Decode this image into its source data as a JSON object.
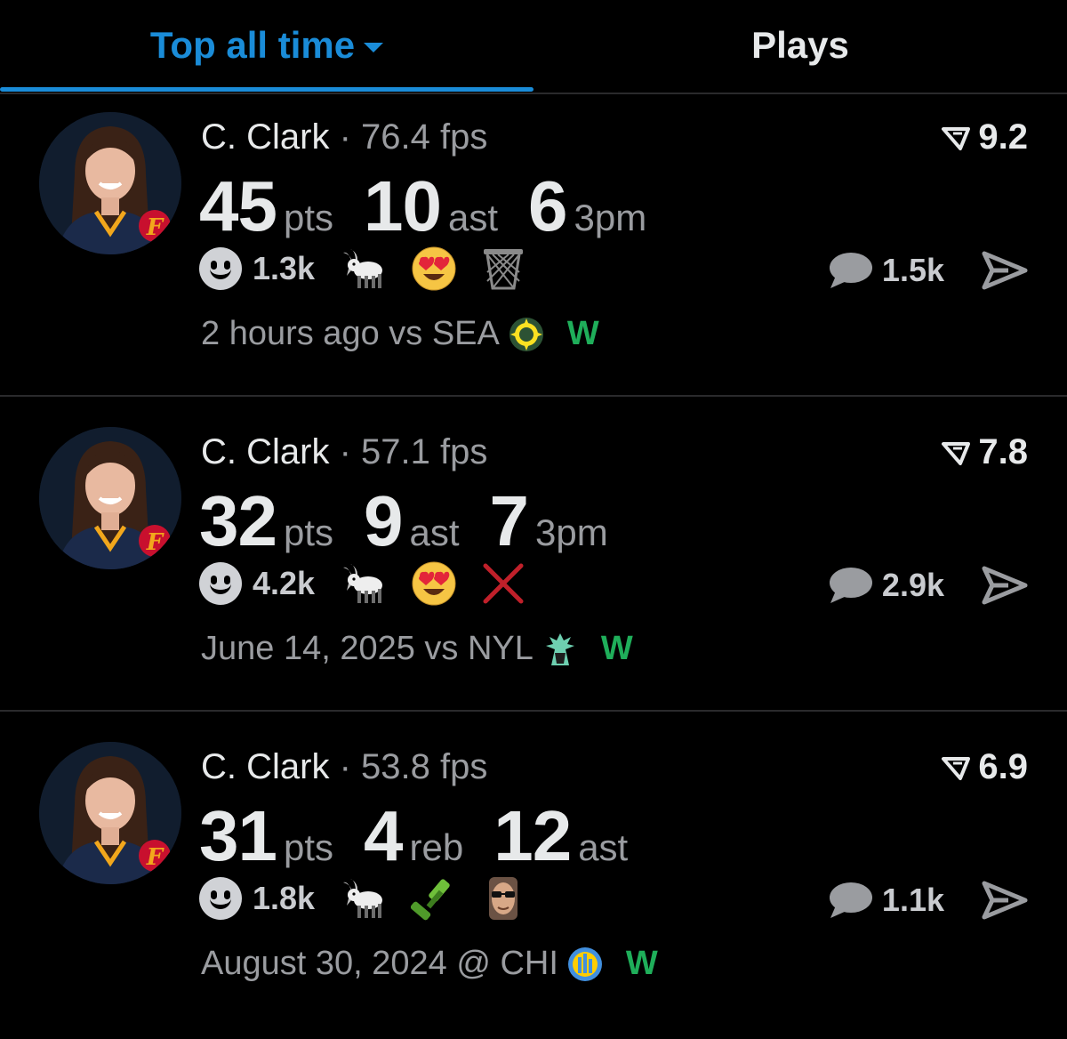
{
  "tabs": {
    "active_label": "Top all time",
    "other_label": "Plays"
  },
  "colors": {
    "accent": "#1a8cd8",
    "win": "#1fae5a",
    "muted": "#9a9ca0"
  },
  "plays": [
    {
      "name": "C. Clark",
      "separator": "·",
      "fps": "76.4 fps",
      "score": "9.2",
      "stats": [
        {
          "num": "45",
          "unit": "pts"
        },
        {
          "num": "10",
          "unit": "ast"
        },
        {
          "num": "6",
          "unit": "3pm"
        }
      ],
      "reaction_count": "1.3k",
      "emojis": [
        "goat-emoji",
        "heart-eyes-emoji",
        "basketball-hoop-emoji"
      ],
      "comment_count": "1.5k",
      "meta": "2 hours ago vs SEA",
      "team_logo": "seattle-storm-logo",
      "result": "W"
    },
    {
      "name": "C. Clark",
      "separator": "·",
      "fps": "57.1 fps",
      "score": "7.8",
      "stats": [
        {
          "num": "32",
          "unit": "pts"
        },
        {
          "num": "9",
          "unit": "ast"
        },
        {
          "num": "7",
          "unit": "3pm"
        }
      ],
      "reaction_count": "4.2k",
      "emojis": [
        "goat-emoji",
        "heart-eyes-emoji",
        "cross-mark-emoji"
      ],
      "comment_count": "2.9k",
      "meta": "June 14, 2025 vs NYL",
      "team_logo": "new-york-liberty-logo",
      "result": "W"
    },
    {
      "name": "C. Clark",
      "separator": "·",
      "fps": "53.8 fps",
      "score": "6.9",
      "stats": [
        {
          "num": "31",
          "unit": "pts"
        },
        {
          "num": "4",
          "unit": "reb"
        },
        {
          "num": "12",
          "unit": "ast"
        }
      ],
      "reaction_count": "1.8k",
      "emojis": [
        "goat-emoji",
        "razor-emoji",
        "sunglasses-face-emoji"
      ],
      "comment_count": "1.1k",
      "meta": "August 30, 2024 @ CHI",
      "team_logo": "chicago-sky-logo",
      "result": "W"
    }
  ]
}
